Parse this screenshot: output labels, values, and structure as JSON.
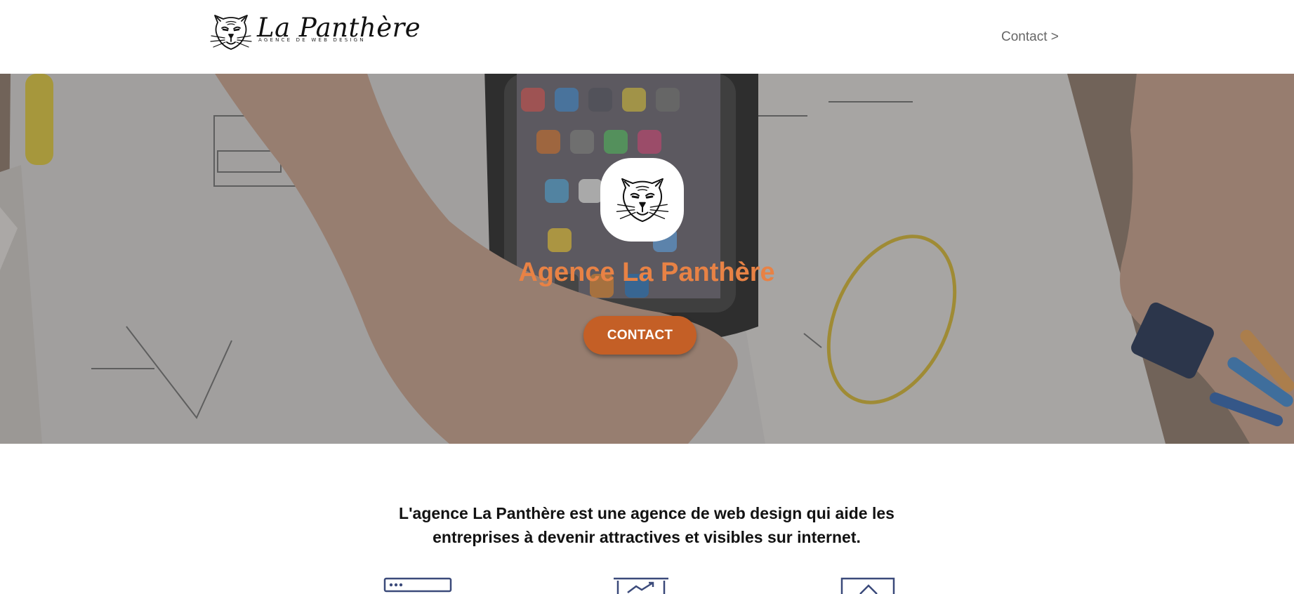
{
  "header": {
    "brand_name": "La Panthère",
    "brand_tagline": "Agence de web design",
    "nav_contact": "Contact >"
  },
  "hero": {
    "title": "Agence La Panthère",
    "cta_label": "CONTACT"
  },
  "intro": {
    "text": "L'agence La Panthère est une agence de web design qui aide les entreprises à devenir attractives et visibles sur internet."
  },
  "features": {
    "icons": [
      "browser-window-icon",
      "presentation-chart-icon",
      "design-frame-icon"
    ]
  },
  "colors": {
    "accent_orange": "#e88245",
    "cta_orange": "#c45f26",
    "icon_navy": "#3b4a7a",
    "nav_text": "#666666"
  }
}
